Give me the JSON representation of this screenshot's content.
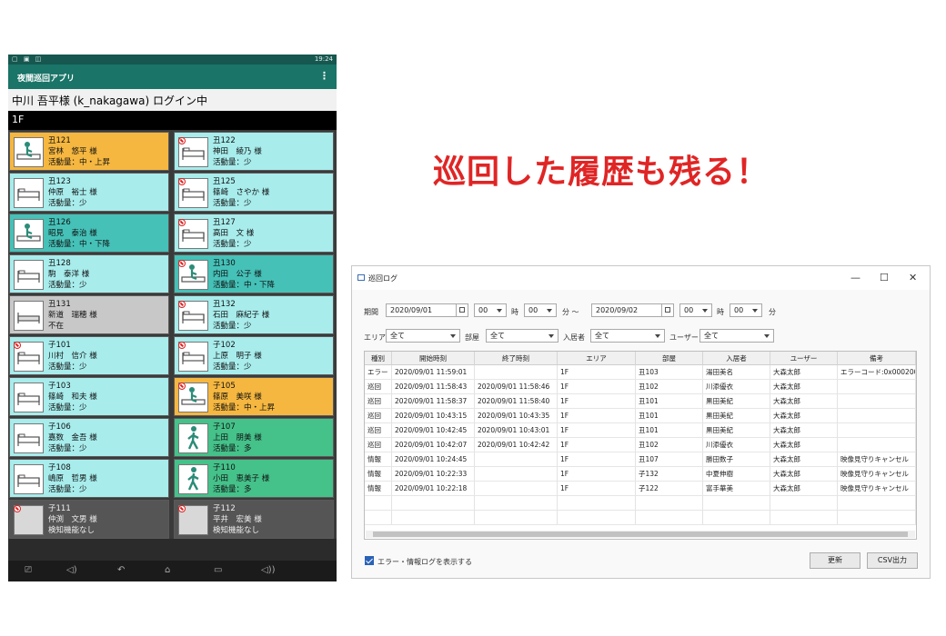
{
  "tablet": {
    "status_left": "▢ ▣ ◫",
    "status_time": "19:24",
    "app_title": "夜間巡回アプリ",
    "menu_glyph": "⋮",
    "user_line": "中川 吾平様 (k_nakagawa) ログイン中",
    "floor": "1F",
    "rooms": [
      {
        "room": "丑121",
        "name": "宮林　悠平 様",
        "activity": "活動量：中・上昇",
        "color": "#f5b740",
        "icon": "sitting",
        "nosign": false
      },
      {
        "room": "丑122",
        "name": "神田　綾乃 様",
        "activity": "活動量：少",
        "color": "#a8ecec",
        "icon": "bed",
        "nosign": true
      },
      {
        "room": "丑123",
        "name": "仲原　裕士 様",
        "activity": "活動量：少",
        "color": "#a8ecec",
        "icon": "bed",
        "nosign": false
      },
      {
        "room": "丑125",
        "name": "篠崎　さやか 様",
        "activity": "活動量：少",
        "color": "#a8ecec",
        "icon": "bed",
        "nosign": true
      },
      {
        "room": "丑126",
        "name": "昭見　泰治 様",
        "activity": "活動量：中・下降",
        "color": "#45c1b8",
        "icon": "sitting",
        "nosign": false
      },
      {
        "room": "丑127",
        "name": "高田　文 様",
        "activity": "活動量：少",
        "color": "#a8ecec",
        "icon": "bed",
        "nosign": true
      },
      {
        "room": "丑128",
        "name": "駒　泰洋 様",
        "activity": "活動量：少",
        "color": "#a8ecec",
        "icon": "bed",
        "nosign": false
      },
      {
        "room": "丑130",
        "name": "内田　公子 様",
        "activity": "活動量：中・下降",
        "color": "#45c1b8",
        "icon": "sitting",
        "nosign": true
      },
      {
        "room": "丑131",
        "name": "新道　瑞穂 様",
        "activity": "不在",
        "color": "#c8c8c8",
        "icon": "bed-empty",
        "nosign": false
      },
      {
        "room": "丑132",
        "name": "石田　麻紀子 様",
        "activity": "活動量：少",
        "color": "#a8ecec",
        "icon": "bed",
        "nosign": true
      },
      {
        "room": "子101",
        "name": "川村　信介 様",
        "activity": "活動量：少",
        "color": "#a8ecec",
        "icon": "bed",
        "nosign": true
      },
      {
        "room": "子102",
        "name": "上原　明子 様",
        "activity": "活動量：少",
        "color": "#a8ecec",
        "icon": "bed",
        "nosign": true
      },
      {
        "room": "子103",
        "name": "篠崎　和夫 様",
        "activity": "活動量：少",
        "color": "#a8ecec",
        "icon": "bed",
        "nosign": false
      },
      {
        "room": "子105",
        "name": "篠原　美咲 様",
        "activity": "活動量：中・上昇",
        "color": "#f5b740",
        "icon": "sitting",
        "nosign": true
      },
      {
        "room": "子106",
        "name": "嘉数　金吾 様",
        "activity": "活動量：少",
        "color": "#a8ecec",
        "icon": "bed",
        "nosign": false
      },
      {
        "room": "子107",
        "name": "上田　朋美 様",
        "activity": "活動量：多",
        "color": "#45c18a",
        "icon": "walking",
        "nosign": false
      },
      {
        "room": "子108",
        "name": "嶋原　哲男 様",
        "activity": "活動量：少",
        "color": "#a8ecec",
        "icon": "bed",
        "nosign": false
      },
      {
        "room": "子110",
        "name": "小田　恵美子 様",
        "activity": "活動量：多",
        "color": "#45c18a",
        "icon": "walking",
        "nosign": false
      },
      {
        "room": "子111",
        "name": "仲渕　文男 様",
        "activity": "検知機能なし",
        "color": "#555555",
        "icon": "blank",
        "nosign": true
      },
      {
        "room": "子112",
        "name": "平井　宏美 様",
        "activity": "検知機能なし",
        "color": "#555555",
        "icon": "blank",
        "nosign": true
      }
    ],
    "nav": [
      "⎚",
      "◁)",
      "↶",
      "⌂",
      "▭",
      "◁))"
    ]
  },
  "headline": "巡回した履歴も残る！",
  "window": {
    "title": "巡回ログ",
    "controls": [
      "—",
      "☐",
      "✕"
    ],
    "period_label": "期間",
    "date_from": "2020/09/01",
    "date_to": "2020/09/02",
    "hour_from": "00",
    "min_from": "00",
    "hour_to": "00",
    "min_to": "00",
    "hour_unit": "時",
    "min_unit": "分 ～",
    "min_unit_end": "分",
    "area_label": "エリア",
    "area_value": "全て",
    "room_label": "部屋",
    "room_value": "全て",
    "resident_label": "入居者",
    "resident_value": "全て",
    "user_label": "ユーザー",
    "user_value": "全て",
    "columns": [
      "種別",
      "開始時刻",
      "終了時刻",
      "エリア",
      "部屋",
      "入居者",
      "ユーザー",
      "備考"
    ],
    "rows": [
      [
        "エラー",
        "2020/09/01 11:59:01",
        "",
        "1F",
        "丑103",
        "湯田美名",
        "大森太郎",
        "エラーコード:0x00020001"
      ],
      [
        "巡回",
        "2020/09/01 11:58:43",
        "2020/09/01 11:58:46",
        "1F",
        "丑102",
        "川添優衣",
        "大森太郎",
        ""
      ],
      [
        "巡回",
        "2020/09/01 11:58:37",
        "2020/09/01 11:58:40",
        "1F",
        "丑101",
        "黒田美紀",
        "大森太郎",
        ""
      ],
      [
        "巡回",
        "2020/09/01 10:43:15",
        "2020/09/01 10:43:35",
        "1F",
        "丑101",
        "黒田美紀",
        "大森太郎",
        ""
      ],
      [
        "巡回",
        "2020/09/01 10:42:45",
        "2020/09/01 10:43:01",
        "1F",
        "丑101",
        "黒田美紀",
        "大森太郎",
        ""
      ],
      [
        "巡回",
        "2020/09/01 10:42:07",
        "2020/09/01 10:42:42",
        "1F",
        "丑102",
        "川添優衣",
        "大森太郎",
        ""
      ],
      [
        "情報",
        "2020/09/01 10:24:45",
        "",
        "1F",
        "丑107",
        "勝田数子",
        "大森太郎",
        "映像見守りキャンセル"
      ],
      [
        "情報",
        "2020/09/01 10:22:33",
        "",
        "1F",
        "子132",
        "中夏伸樹",
        "大森太郎",
        "映像見守りキャンセル"
      ],
      [
        "情報",
        "2020/09/01 10:22:18",
        "",
        "1F",
        "子122",
        "富手華美",
        "大森太郎",
        "映像見守りキャンセル"
      ]
    ],
    "checkbox_label": "エラー・情報ログを表示する",
    "refresh_button": "更新",
    "csv_button": "CSV出力"
  }
}
